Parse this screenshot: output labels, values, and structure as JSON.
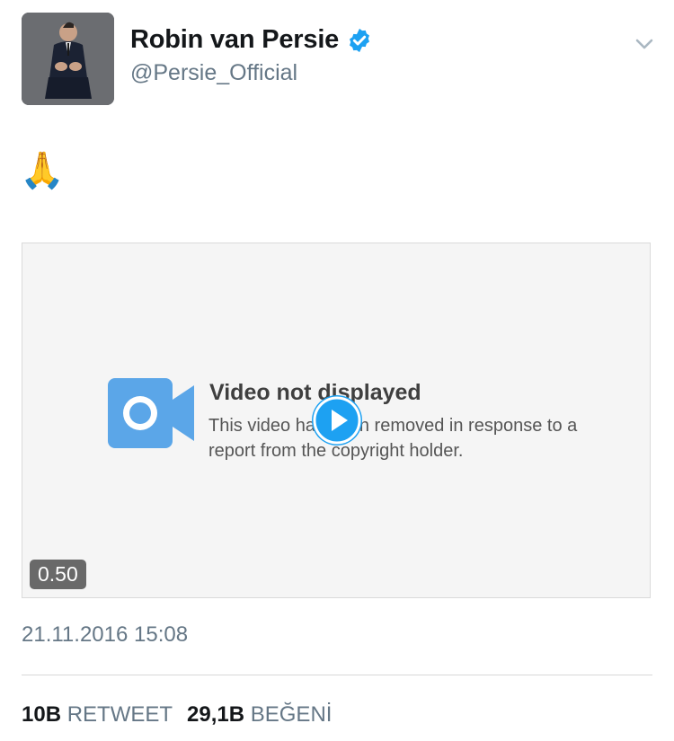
{
  "tweet": {
    "author": {
      "display_name": "Robin van Persie",
      "handle": "@Persie_Official",
      "verified": true,
      "avatar": "avatar"
    },
    "text": "🙏",
    "media": {
      "notice_title": "Video not displayed",
      "notice_message": "This video has been removed in response to a report from the copyright holder.",
      "duration": "0.50",
      "play_icon": "play-icon",
      "camera_icon": "video-camera-icon"
    },
    "timestamp": "21.11.2016 15:08",
    "stats": {
      "retweets": "10B",
      "retweets_label": "RETWEET",
      "likes": "29,1B",
      "likes_label": "BEĞENİ"
    }
  },
  "colors": {
    "accent": "#1da1f2",
    "verified_badge": "#1da1f2",
    "camera_icon": "#5ba6e8",
    "secondary_text": "#657786"
  }
}
